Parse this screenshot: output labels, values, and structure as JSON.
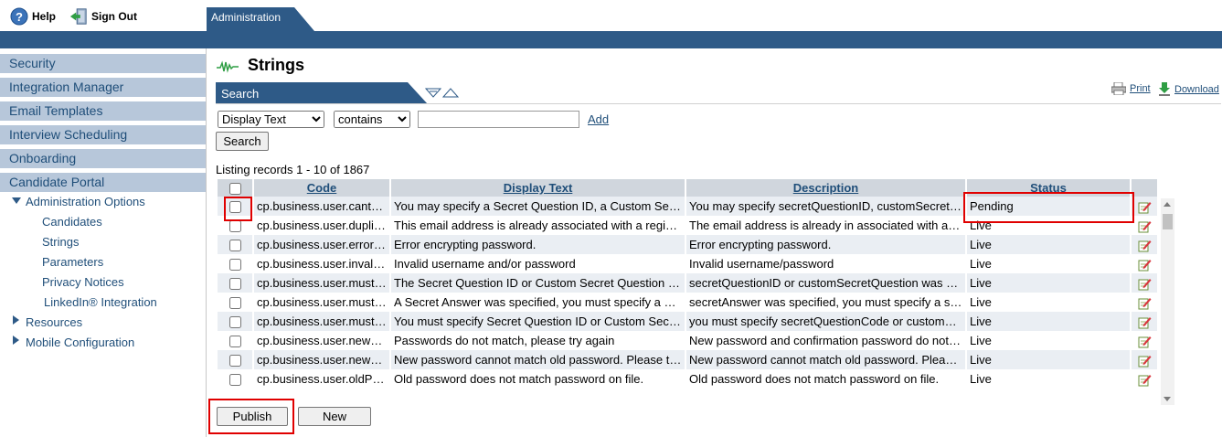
{
  "top": {
    "help_label": "Help",
    "signout_label": "Sign Out",
    "tab_label": "Administration"
  },
  "colors": {
    "brand_blue": "#2e5a87",
    "sidebar_item": "#b7c7da",
    "link": "#1f4e79",
    "highlight": "#e00000"
  },
  "sidebar": {
    "items": [
      "Security",
      "Integration Manager",
      "Email Templates",
      "Interview Scheduling",
      "Onboarding",
      "Candidate Portal"
    ],
    "admin_options": "Administration Options",
    "sub_items": [
      "Candidates",
      "Strings",
      "Parameters",
      "Privacy Notices",
      "LinkedIn® Integration"
    ],
    "resources": "Resources",
    "mobile": "Mobile Configuration"
  },
  "main": {
    "title": "Strings",
    "search_tab": "Search",
    "print": "Print",
    "download": "Download",
    "field_options": [
      "Display Text"
    ],
    "op_options": [
      "contains"
    ],
    "value": "",
    "add": "Add",
    "search_button": "Search",
    "listing": "Listing records 1 - 10 of 1867",
    "publish": "Publish",
    "new": "New"
  },
  "table": {
    "headers": [
      "Code",
      "Display Text",
      "Description",
      "Status"
    ],
    "rows": [
      {
        "code": "cp.business.user.cantSpecifySecretQuestion",
        "text": "You may specify a Secret Question ID, a Custom Secret Question",
        "desc": "You may specify secretQuestionID, customSecretQuestion",
        "status": "Pending"
      },
      {
        "code": "cp.business.user.duplicateEmail",
        "text": "This email address is already associated with a registered user",
        "desc": "The email address is already in associated with another user",
        "status": "Live"
      },
      {
        "code": "cp.business.user.errorEncryptingPassword",
        "text": "Error encrypting password.",
        "desc": "Error encrypting password.",
        "status": "Live"
      },
      {
        "code": "cp.business.user.invalidCredentials",
        "text": "Invalid username and/or password",
        "desc": "Invalid username/password",
        "status": "Live"
      },
      {
        "code": "cp.business.user.mustSpecifySecretAnswer",
        "text": "The Secret Question ID or Custom Secret Question was specified",
        "desc": "secretQuestionID or customSecretQuestion was specified",
        "status": "Live"
      },
      {
        "code": "cp.business.user.mustSpecifySecretQuestion",
        "text": "A Secret Answer was specified, you must specify a Secret Question",
        "desc": "secretAnswer was specified, you must specify a secret question",
        "status": "Live"
      },
      {
        "code": "cp.business.user.mustSpecifySecretQuestionCode",
        "text": "You must specify Secret Question ID or Custom Secret Question",
        "desc": "you must specify secretQuestionCode or customSecretQuestion",
        "status": "Live"
      },
      {
        "code": "cp.business.user.newPasswordMismatch",
        "text": "Passwords do not match, please try again",
        "desc": "New password and confirmation password do not match",
        "status": "Live"
      },
      {
        "code": "cp.business.user.newPasswordSameAsOld",
        "text": "New password cannot match old password. Please try again",
        "desc": "New password cannot match old password. Please try again",
        "status": "Live"
      },
      {
        "code": "cp.business.user.oldPasswordMismatch",
        "text": "Old password does not match password on file.",
        "desc": "Old password does not match password on file.",
        "status": "Live"
      }
    ]
  }
}
